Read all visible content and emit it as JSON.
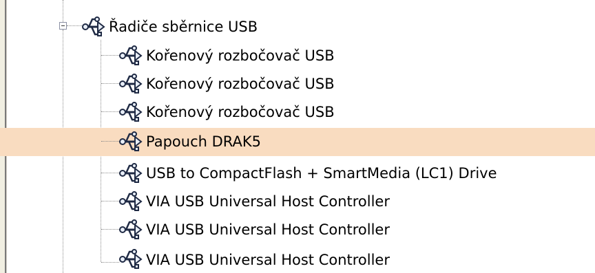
{
  "device_tree": {
    "group": {
      "label": "Řadiče sběrnice USB",
      "expanded": true,
      "icon": "usb-icon"
    },
    "children": [
      {
        "label": "Kořenový rozbočovač USB",
        "icon": "usb-icon",
        "selected": false
      },
      {
        "label": "Kořenový rozbočovač USB",
        "icon": "usb-icon",
        "selected": false
      },
      {
        "label": "Kořenový rozbočovač USB",
        "icon": "usb-icon",
        "selected": false
      },
      {
        "label": "Papouch DRAK5",
        "icon": "usb-icon",
        "selected": true
      },
      {
        "label": "USB to CompactFlash + SmartMedia (LC1) Drive",
        "icon": "usb-icon",
        "selected": false
      },
      {
        "label": "VIA USB Universal Host Controller",
        "icon": "usb-icon",
        "selected": false
      },
      {
        "label": "VIA USB Universal Host Controller",
        "icon": "usb-icon",
        "selected": false
      },
      {
        "label": "VIA USB Universal Host Controller",
        "icon": "usb-icon",
        "selected": false
      }
    ],
    "colors": {
      "selection": "#f9dcc0",
      "connector": "#8a8a8a"
    }
  }
}
